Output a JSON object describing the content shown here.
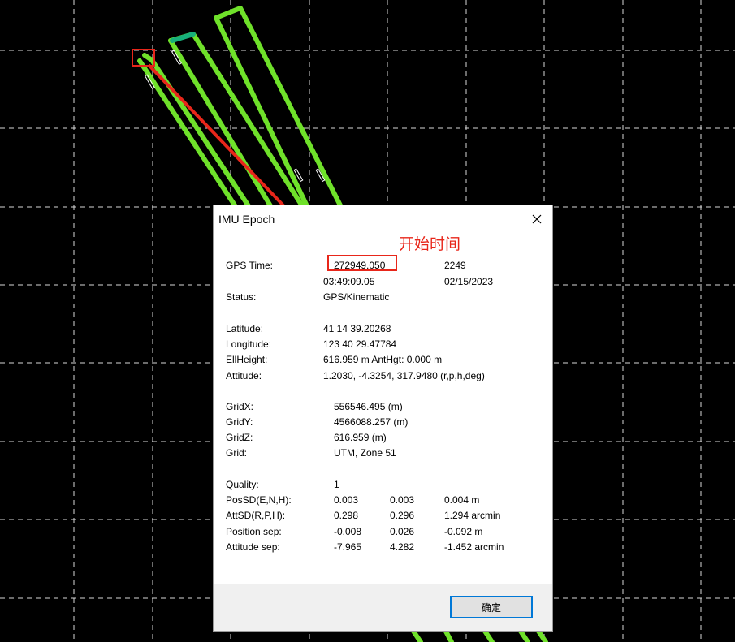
{
  "dialog": {
    "title": "IMU Epoch",
    "close_symbol": "×",
    "annotation": "开始时间",
    "ok_label": "确定",
    "gps_time": {
      "label": "GPS Time:",
      "seconds": "272949.050",
      "week": "2249",
      "time": "03:49:09.05",
      "date": "02/15/2023"
    },
    "status": {
      "label": "Status:",
      "value": "GPS/Kinematic"
    },
    "latitude": {
      "label": "Latitude:",
      "value": "41 14 39.20268"
    },
    "longitude": {
      "label": "Longitude:",
      "value": "123 40 29.47784"
    },
    "ellheight": {
      "label": "EllHeight:",
      "value": "616.959 m  AntHgt: 0.000 m"
    },
    "attitude": {
      "label": "Attitude:",
      "value": "1.2030, -4.3254, 317.9480 (r,p,h,deg)"
    },
    "gridx": {
      "label": "GridX:",
      "value": "556546.495 (m)"
    },
    "gridy": {
      "label": "GridY:",
      "value": "4566088.257 (m)"
    },
    "gridz": {
      "label": "GridZ:",
      "value": "616.959 (m)"
    },
    "grid": {
      "label": "Grid:",
      "value": "UTM, Zone 51"
    },
    "quality": {
      "label": "Quality:",
      "value": "1"
    },
    "possd": {
      "label": "PosSD(E,N,H):",
      "v1": "0.003",
      "v2": "0.003",
      "v3": "0.004 m"
    },
    "attsd": {
      "label": "AttSD(R,P,H):",
      "v1": "0.298",
      "v2": "0.296",
      "v3": "1.294 arcmin"
    },
    "position_sep": {
      "label": "Position sep:",
      "v1": "-0.008",
      "v2": "0.026",
      "v3": "-0.092 m"
    },
    "attitude_sep": {
      "label": "Attitude sep:",
      "v1": "-7.965",
      "v2": "4.282",
      "v3": "-1.452 arcmin"
    }
  },
  "colors": {
    "background": "#000000",
    "grid_line": "#ffffff",
    "trajectory": "#6fe12a",
    "trajectory_highlight": "#17b07a",
    "annotation": "#e8261a",
    "button_focus": "#0078d7"
  },
  "icons": {
    "close": "close-icon",
    "trajectory": "trajectory-lines",
    "arrow": "red-arrow"
  }
}
